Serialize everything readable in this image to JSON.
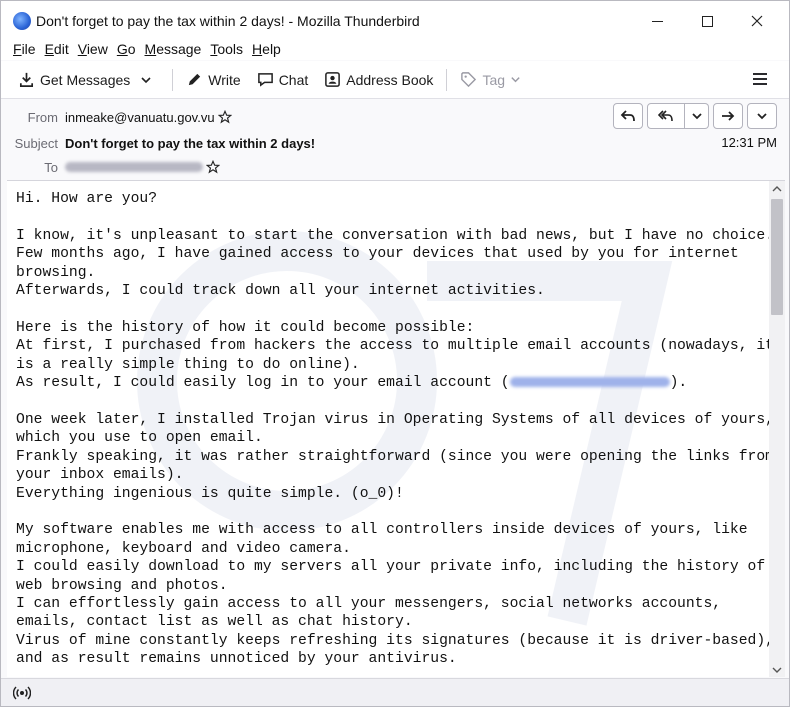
{
  "window": {
    "title": "Don't forget to pay the tax within 2 days! - Mozilla Thunderbird"
  },
  "menu": [
    "File",
    "Edit",
    "View",
    "Go",
    "Message",
    "Tools",
    "Help"
  ],
  "toolbar": {
    "get_messages": "Get Messages",
    "write": "Write",
    "chat": "Chat",
    "address_book": "Address Book",
    "tag": "Tag"
  },
  "header": {
    "from_label": "From",
    "from_value": "inmeake@vanuatu.gov.vu",
    "subject_label": "Subject",
    "subject_value": "Don't forget to pay the tax within 2 days!",
    "to_label": "To",
    "time": "12:31 PM"
  },
  "message": {
    "lines": [
      "Hi. How are you?",
      "",
      "I know, it's unpleasant to start the conversation with bad news, but I have no choice.",
      "Few months ago, I have gained access to your devices that used by you for internet",
      "browsing.",
      "Afterwards, I could track down all your internet activities.",
      "",
      "Here is the history of how it could become possible:",
      "At first, I purchased from hackers the access to multiple email accounts (nowadays, it",
      "is a really simple thing to do online).",
      "As result, I could easily log in to your email account (",
      "",
      "One week later, I installed Trojan virus in Operating Systems of all devices of yours,",
      "which you use to open email.",
      "Frankly speaking, it was rather straightforward (since you were opening the links from",
      "your inbox emails).",
      "Everything ingenious is quite simple. (o_0)!",
      "",
      "My software enables me with access to all controllers inside devices of yours, like",
      "microphone, keyboard and video camera.",
      "I could easily download to my servers all your private info, including the history of",
      "web browsing and photos.",
      "I can effortlessly gain access to all your messengers, social networks accounts,",
      "emails, contact list as well as chat history.",
      "Virus of mine constantly keeps refreshing its signatures (because it is driver-based),",
      "and as result remains unnoticed by your antivirus."
    ],
    "line_suffix": ")."
  },
  "colors": {
    "accent": "#2a63d6",
    "redaction": "#9fb2ea"
  }
}
